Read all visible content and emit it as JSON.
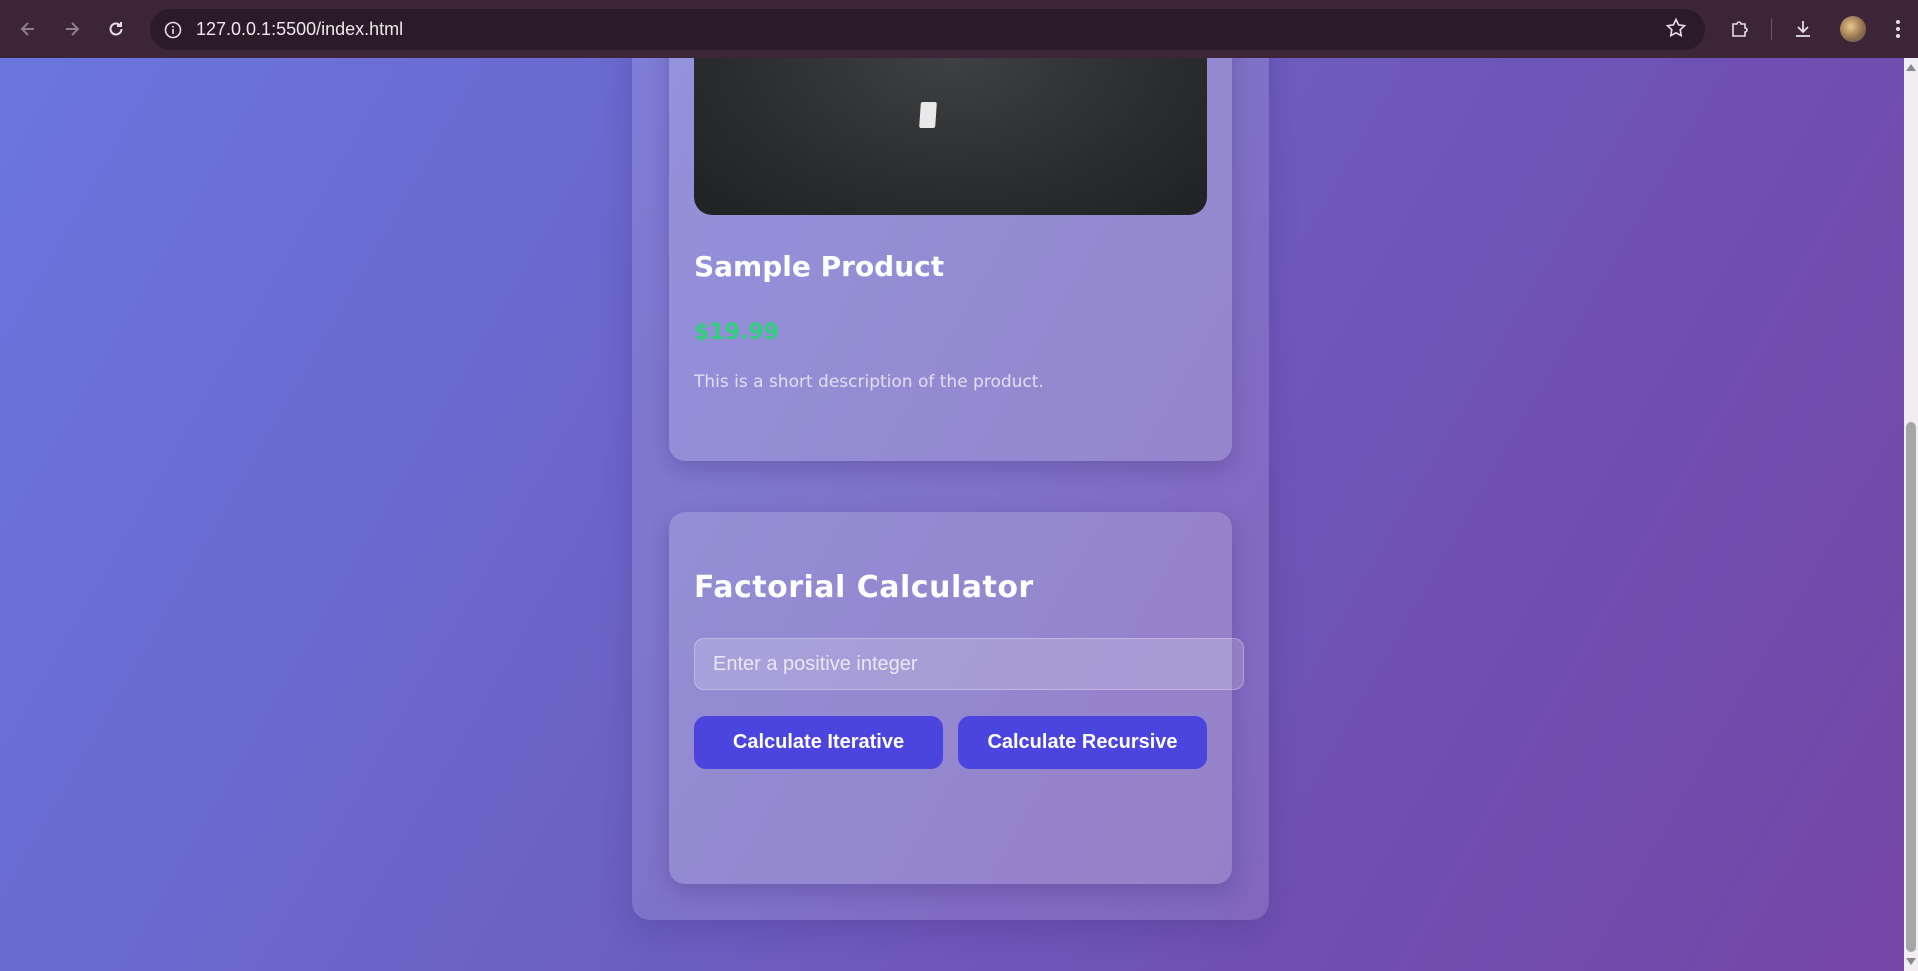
{
  "browser": {
    "url": "127.0.0.1:5500/index.html",
    "icons": {
      "back": "back-arrow-icon",
      "forward": "forward-arrow-icon",
      "reload": "reload-icon",
      "site_info": "info-icon",
      "bookmark": "star-icon",
      "extensions": "puzzle-icon",
      "downloads": "download-icon",
      "profile": "avatar",
      "menu": "kebab-menu-icon"
    }
  },
  "product": {
    "title": "Sample Product",
    "price": "$19.99",
    "description": "This is a short description of the product."
  },
  "calculator": {
    "title": "Factorial Calculator",
    "input_placeholder": "Enter a positive integer",
    "input_value": "",
    "iterative_label": "Calculate Iterative",
    "recursive_label": "Calculate Recursive"
  },
  "colors": {
    "price": "#2fcf7c",
    "button": "#4c44de",
    "background_start": "#6a76df",
    "background_end": "#7446a6"
  }
}
